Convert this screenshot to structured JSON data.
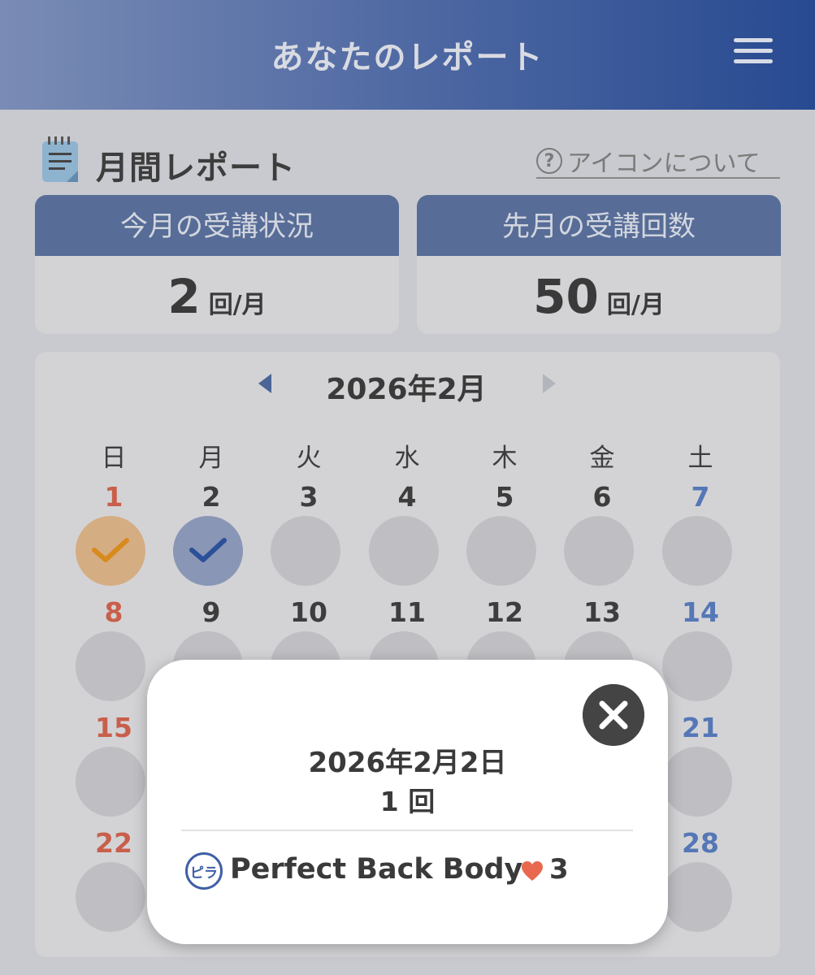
{
  "header": {
    "title": "あなたのレポート",
    "menu_icon": "hamburger-menu-icon"
  },
  "section": {
    "icon": "notepad-icon",
    "title": "月間レポート",
    "help_icon": "question-circle-icon",
    "help_link": "アイコンについて"
  },
  "stats": {
    "this_month": {
      "label": "今月の受講状況",
      "value": "2",
      "unit": "回/月"
    },
    "last_month": {
      "label": "先月の受講回数",
      "value": "50",
      "unit": "回/月"
    }
  },
  "calendar": {
    "month_label": "2026年2月",
    "weekdays": [
      "日",
      "月",
      "火",
      "水",
      "木",
      "金",
      "土"
    ],
    "weeks": [
      [
        "1",
        "2",
        "3",
        "4",
        "5",
        "6",
        "7"
      ],
      [
        "8",
        "9",
        "10",
        "11",
        "12",
        "13",
        "14"
      ],
      [
        "15",
        "",
        "",
        "",
        "",
        "",
        "21"
      ],
      [
        "22",
        "",
        "",
        "",
        "",
        "",
        "28"
      ]
    ],
    "completed_days": [
      {
        "day": "1",
        "status": "orange-check"
      },
      {
        "day": "2",
        "status": "blue-check"
      }
    ],
    "colors": {
      "sunday": "#c85f4a",
      "saturday": "#5577b6",
      "orange": "#d5ad83",
      "blue": "#8996b5"
    }
  },
  "popup": {
    "date": "2026年2月2日",
    "count": "1 回",
    "lesson": {
      "badge": "ピラ",
      "name": "Perfect Back Body",
      "likes": "3"
    },
    "close_icon": "close-x-icon",
    "heart_icon": "heart-icon"
  }
}
